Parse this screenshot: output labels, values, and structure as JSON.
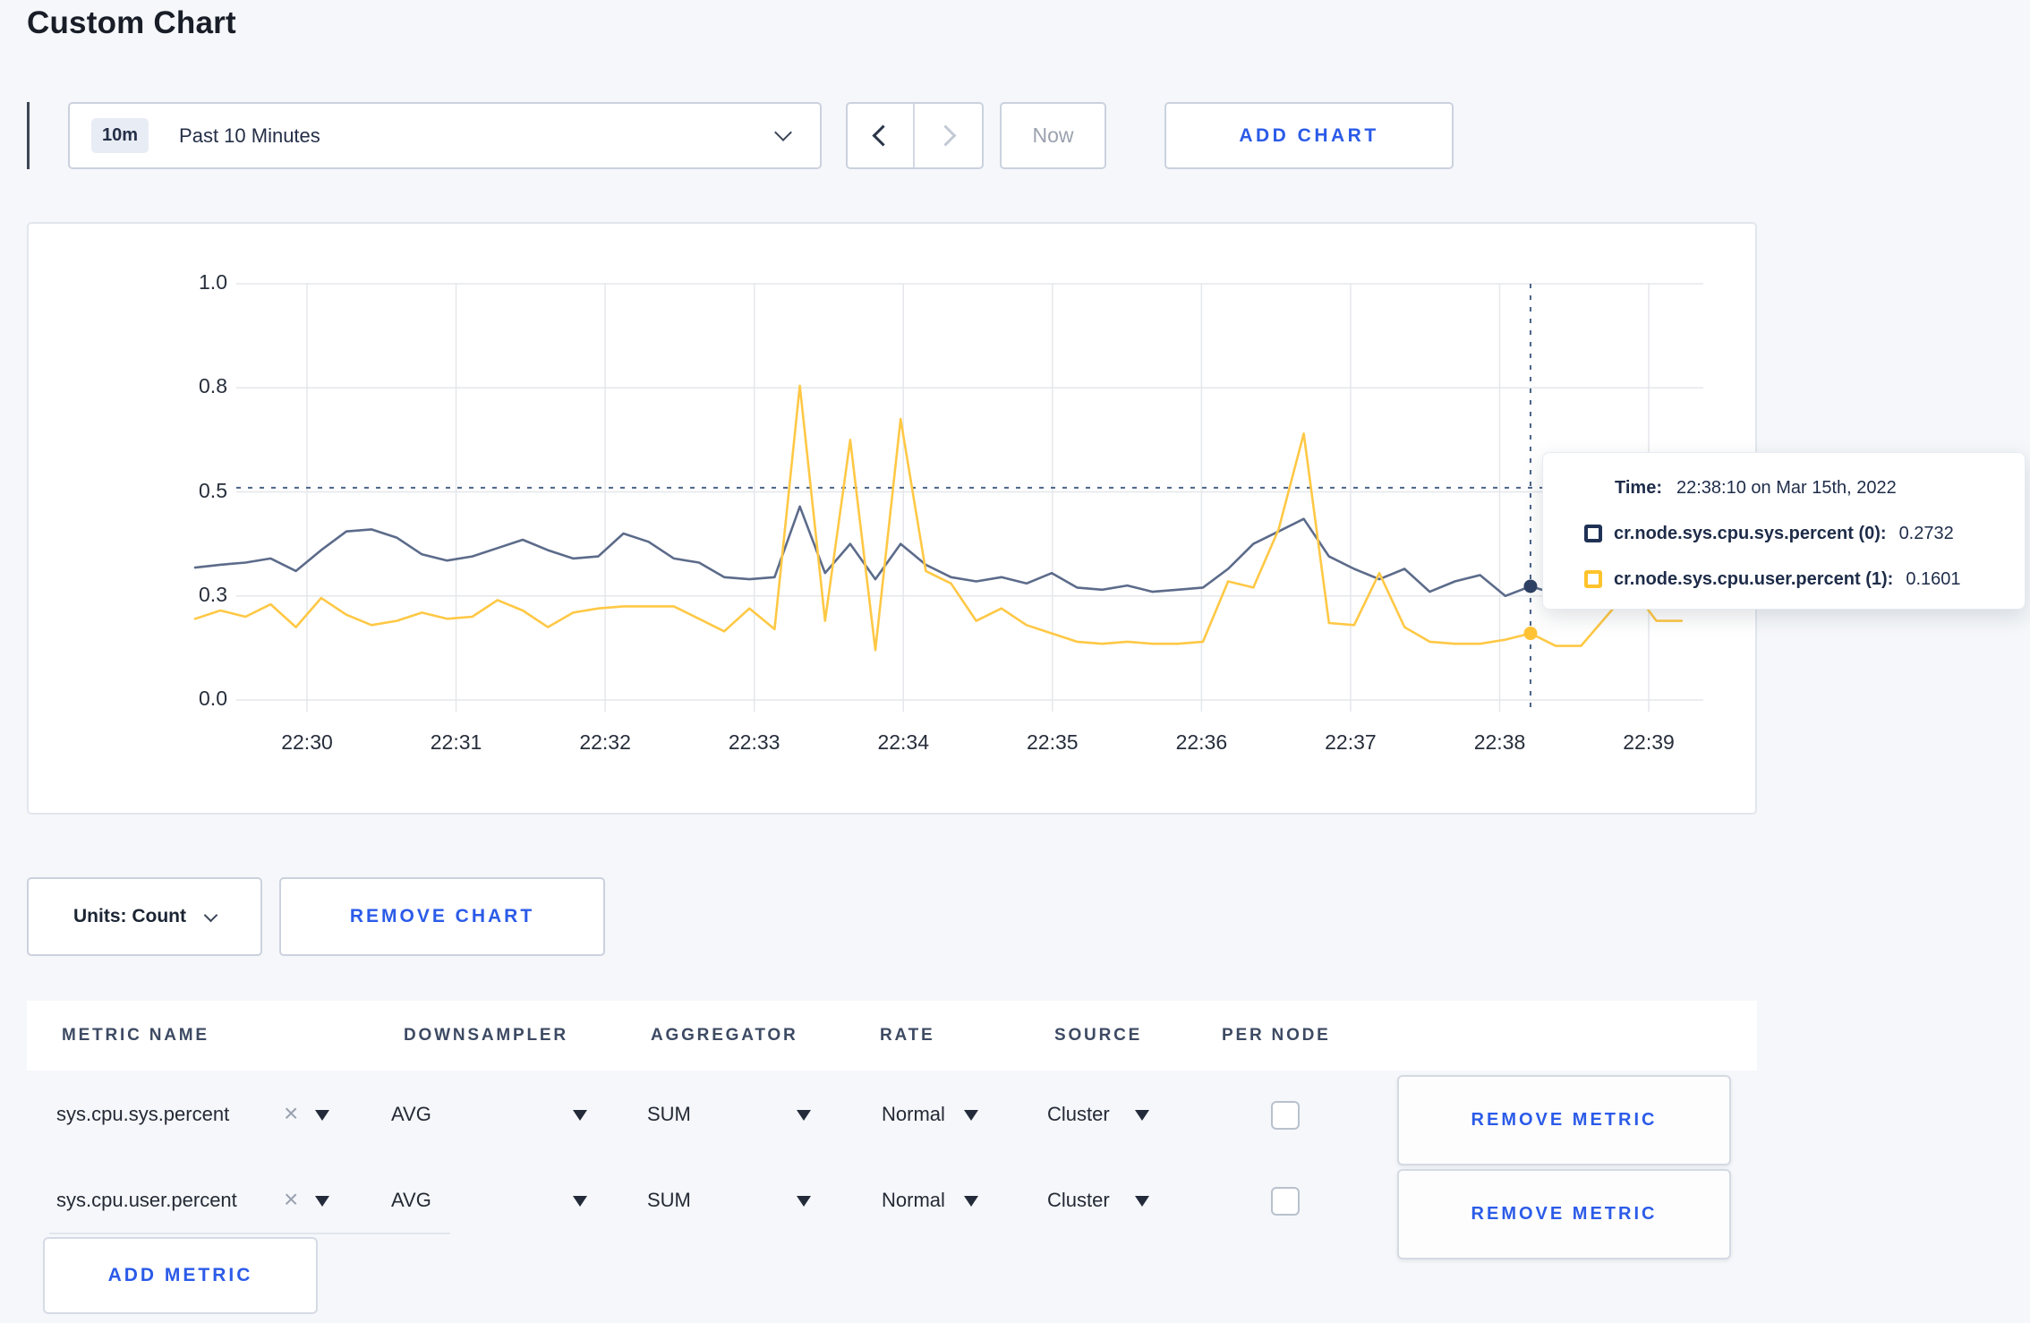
{
  "page": {
    "title": "Custom Chart"
  },
  "toolbar": {
    "time_window_badge": "10m",
    "time_window_label": "Past 10 Minutes",
    "now_label": "Now",
    "add_chart_label": "ADD CHART"
  },
  "chart_data": {
    "type": "line",
    "title": "",
    "xlabel": "",
    "ylabel": "",
    "ylim": [
      0,
      1
    ],
    "grid": true,
    "x": [
      "22:29:20",
      "22:29:30",
      "22:29:40",
      "22:29:50",
      "22:30:00",
      "22:30:10",
      "22:30:20",
      "22:30:30",
      "22:30:40",
      "22:30:50",
      "22:31:00",
      "22:31:10",
      "22:31:20",
      "22:31:30",
      "22:31:40",
      "22:31:50",
      "22:32:00",
      "22:32:10",
      "22:32:20",
      "22:32:30",
      "22:32:40",
      "22:32:50",
      "22:33:00",
      "22:33:10",
      "22:33:20",
      "22:33:30",
      "22:33:40",
      "22:33:50",
      "22:34:00",
      "22:34:10",
      "22:34:20",
      "22:34:30",
      "22:34:40",
      "22:34:50",
      "22:35:00",
      "22:35:10",
      "22:35:20",
      "22:35:30",
      "22:35:40",
      "22:35:50",
      "22:36:00",
      "22:36:10",
      "22:36:20",
      "22:36:30",
      "22:36:40",
      "22:36:50",
      "22:37:00",
      "22:37:10",
      "22:37:20",
      "22:37:30",
      "22:37:40",
      "22:37:50",
      "22:38:00",
      "22:38:10",
      "22:38:20",
      "22:38:30",
      "22:38:40",
      "22:38:50",
      "22:39:00",
      "22:39:10"
    ],
    "series": [
      {
        "name": "cr.node.sys.cpu.sys.percent",
        "id": 0,
        "color": "#5C6B8A",
        "dot_color": "#2E4165",
        "values": [
          0.318,
          0.325,
          0.33,
          0.34,
          0.31,
          0.36,
          0.405,
          0.41,
          0.39,
          0.35,
          0.335,
          0.345,
          0.365,
          0.385,
          0.36,
          0.34,
          0.345,
          0.4,
          0.38,
          0.34,
          0.33,
          0.295,
          0.29,
          0.295,
          0.465,
          0.305,
          0.375,
          0.29,
          0.375,
          0.325,
          0.295,
          0.285,
          0.295,
          0.28,
          0.305,
          0.27,
          0.265,
          0.275,
          0.26,
          0.265,
          0.27,
          0.315,
          0.375,
          0.405,
          0.435,
          0.345,
          0.315,
          0.29,
          0.315,
          0.26,
          0.285,
          0.3,
          0.25,
          0.2732,
          0.255,
          0.27,
          0.3,
          0.32,
          0.3,
          0.305
        ]
      },
      {
        "name": "cr.node.sys.cpu.user.percent",
        "id": 1,
        "color": "#FFC845",
        "dot_color": "#FFC235",
        "values": [
          0.195,
          0.215,
          0.2,
          0.23,
          0.175,
          0.245,
          0.205,
          0.18,
          0.19,
          0.21,
          0.195,
          0.2,
          0.24,
          0.215,
          0.175,
          0.21,
          0.22,
          0.225,
          0.225,
          0.225,
          0.195,
          0.165,
          0.22,
          0.17,
          0.755,
          0.19,
          0.625,
          0.12,
          0.675,
          0.31,
          0.28,
          0.19,
          0.22,
          0.18,
          0.16,
          0.14,
          0.135,
          0.14,
          0.135,
          0.135,
          0.14,
          0.285,
          0.27,
          0.41,
          0.64,
          0.185,
          0.18,
          0.305,
          0.175,
          0.14,
          0.135,
          0.135,
          0.145,
          0.1601,
          0.13,
          0.13,
          0.2,
          0.27,
          0.19,
          0.19
        ]
      }
    ],
    "xticks": [
      "22:30",
      "22:31",
      "22:32",
      "22:33",
      "22:34",
      "22:35",
      "22:36",
      "22:37",
      "22:38",
      "22:39"
    ],
    "yticks": [
      {
        "label": "0.0",
        "value": 0
      },
      {
        "label": "0.3",
        "value": 0.25
      },
      {
        "label": "0.5",
        "value": 0.5
      },
      {
        "label": "0.8",
        "value": 0.75
      },
      {
        "label": "1.0",
        "value": 1.0
      }
    ],
    "legend_position": "tooltip",
    "crosshair": {
      "time": "22:38:10",
      "y_value": 0.51,
      "series_values": [
        0.2732,
        0.1601
      ]
    }
  },
  "tooltip": {
    "time_label": "Time:",
    "time_value": "22:38:10 on Mar 15th, 2022",
    "rows": [
      {
        "name": "cr.node.sys.cpu.sys.percent (0):",
        "value": "0.2732",
        "color": "#1F3155"
      },
      {
        "name": "cr.node.sys.cpu.user.percent (1):",
        "value": "0.1601",
        "color": "#FFC32B"
      }
    ]
  },
  "chart_controls": {
    "units_label": "Units: Count",
    "remove_chart_label": "REMOVE CHART"
  },
  "table": {
    "headers": [
      "METRIC NAME",
      "DOWNSAMPLER",
      "AGGREGATOR",
      "RATE",
      "SOURCE",
      "PER NODE"
    ],
    "rows": [
      {
        "metric": "sys.cpu.sys.percent",
        "downsampler": "AVG",
        "aggregator": "SUM",
        "rate": "Normal",
        "source": "Cluster",
        "per_node_checked": false,
        "remove_label": "REMOVE METRIC"
      },
      {
        "metric": "sys.cpu.user.percent",
        "downsampler": "AVG",
        "aggregator": "SUM",
        "rate": "Normal",
        "source": "Cluster",
        "per_node_checked": false,
        "remove_label": "REMOVE METRIC"
      }
    ],
    "add_metric_label": "ADD METRIC"
  },
  "colors": {
    "accent_blue": "#2B5BE8",
    "page_background": "#F5F7FA",
    "grid_line": "#E5E7EB",
    "crosshair": "#4A6288"
  }
}
